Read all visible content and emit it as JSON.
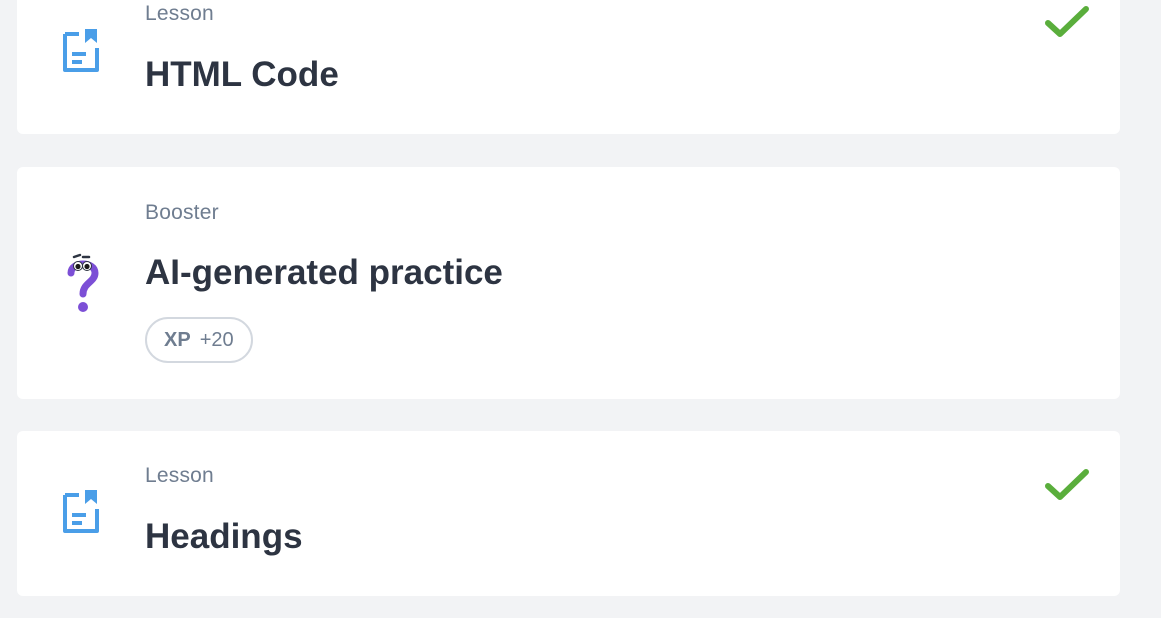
{
  "items": [
    {
      "type_label": "Lesson",
      "title": "HTML Code",
      "icon": "lesson-document-icon",
      "completed": true,
      "status_icon": "checkmark-icon"
    },
    {
      "type_label": "Booster",
      "title": "AI-generated practice",
      "icon": "question-mark-character-icon",
      "xp": {
        "label": "XP",
        "value": "+20"
      }
    },
    {
      "type_label": "Lesson",
      "title": "Headings",
      "icon": "lesson-document-icon",
      "completed": true,
      "status_icon": "checkmark-icon"
    }
  ],
  "colors": {
    "page_background": "#f2f3f5",
    "card_background": "#ffffff",
    "lesson_icon": "#4a9ee8",
    "booster_icon": "#7c4fd6",
    "check": "#5aae3c",
    "title_text": "#2d3442",
    "muted_text": "#6f7d90"
  }
}
